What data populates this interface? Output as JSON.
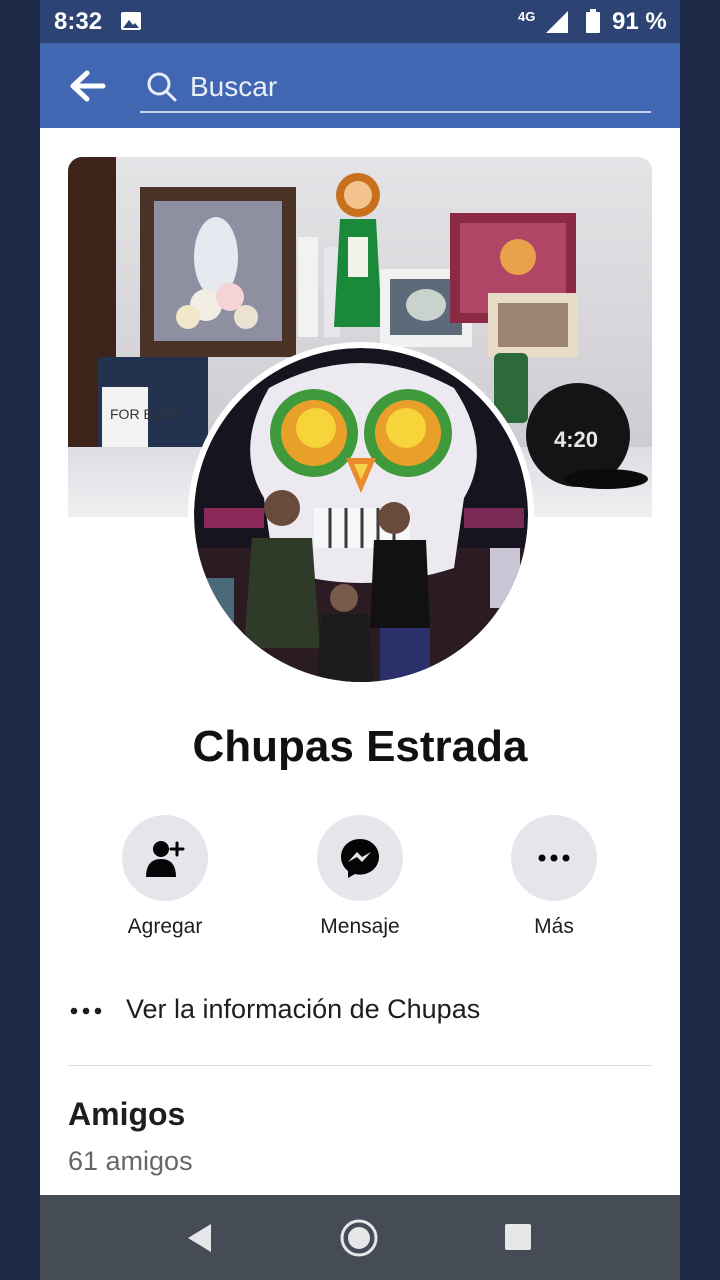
{
  "status_bar": {
    "time": "8:32",
    "network": "4G",
    "battery": "91 %",
    "icons": [
      "photo-icon",
      "signal-icon",
      "battery-icon"
    ]
  },
  "header": {
    "back_icon": "back-arrow-icon",
    "search_placeholder": "Buscar",
    "colors": {
      "status_bar": "#2d4373",
      "header": "#4267b2"
    }
  },
  "cover": {
    "text_forever": "FOR EVER",
    "text_cap": "4:20"
  },
  "profile": {
    "name": "Chupas Estrada"
  },
  "actions": [
    {
      "label": "Agregar",
      "icon": "add-friend-icon"
    },
    {
      "label": "Mensaje",
      "icon": "messenger-icon"
    },
    {
      "label": "Más",
      "icon": "more-icon"
    }
  ],
  "info": {
    "text": "Ver la información de Chupas"
  },
  "friends": {
    "title": "Amigos",
    "count": "61 amigos"
  },
  "nav_bar": {
    "icons": [
      "nav-back-icon",
      "nav-home-icon",
      "nav-recents-icon"
    ]
  }
}
